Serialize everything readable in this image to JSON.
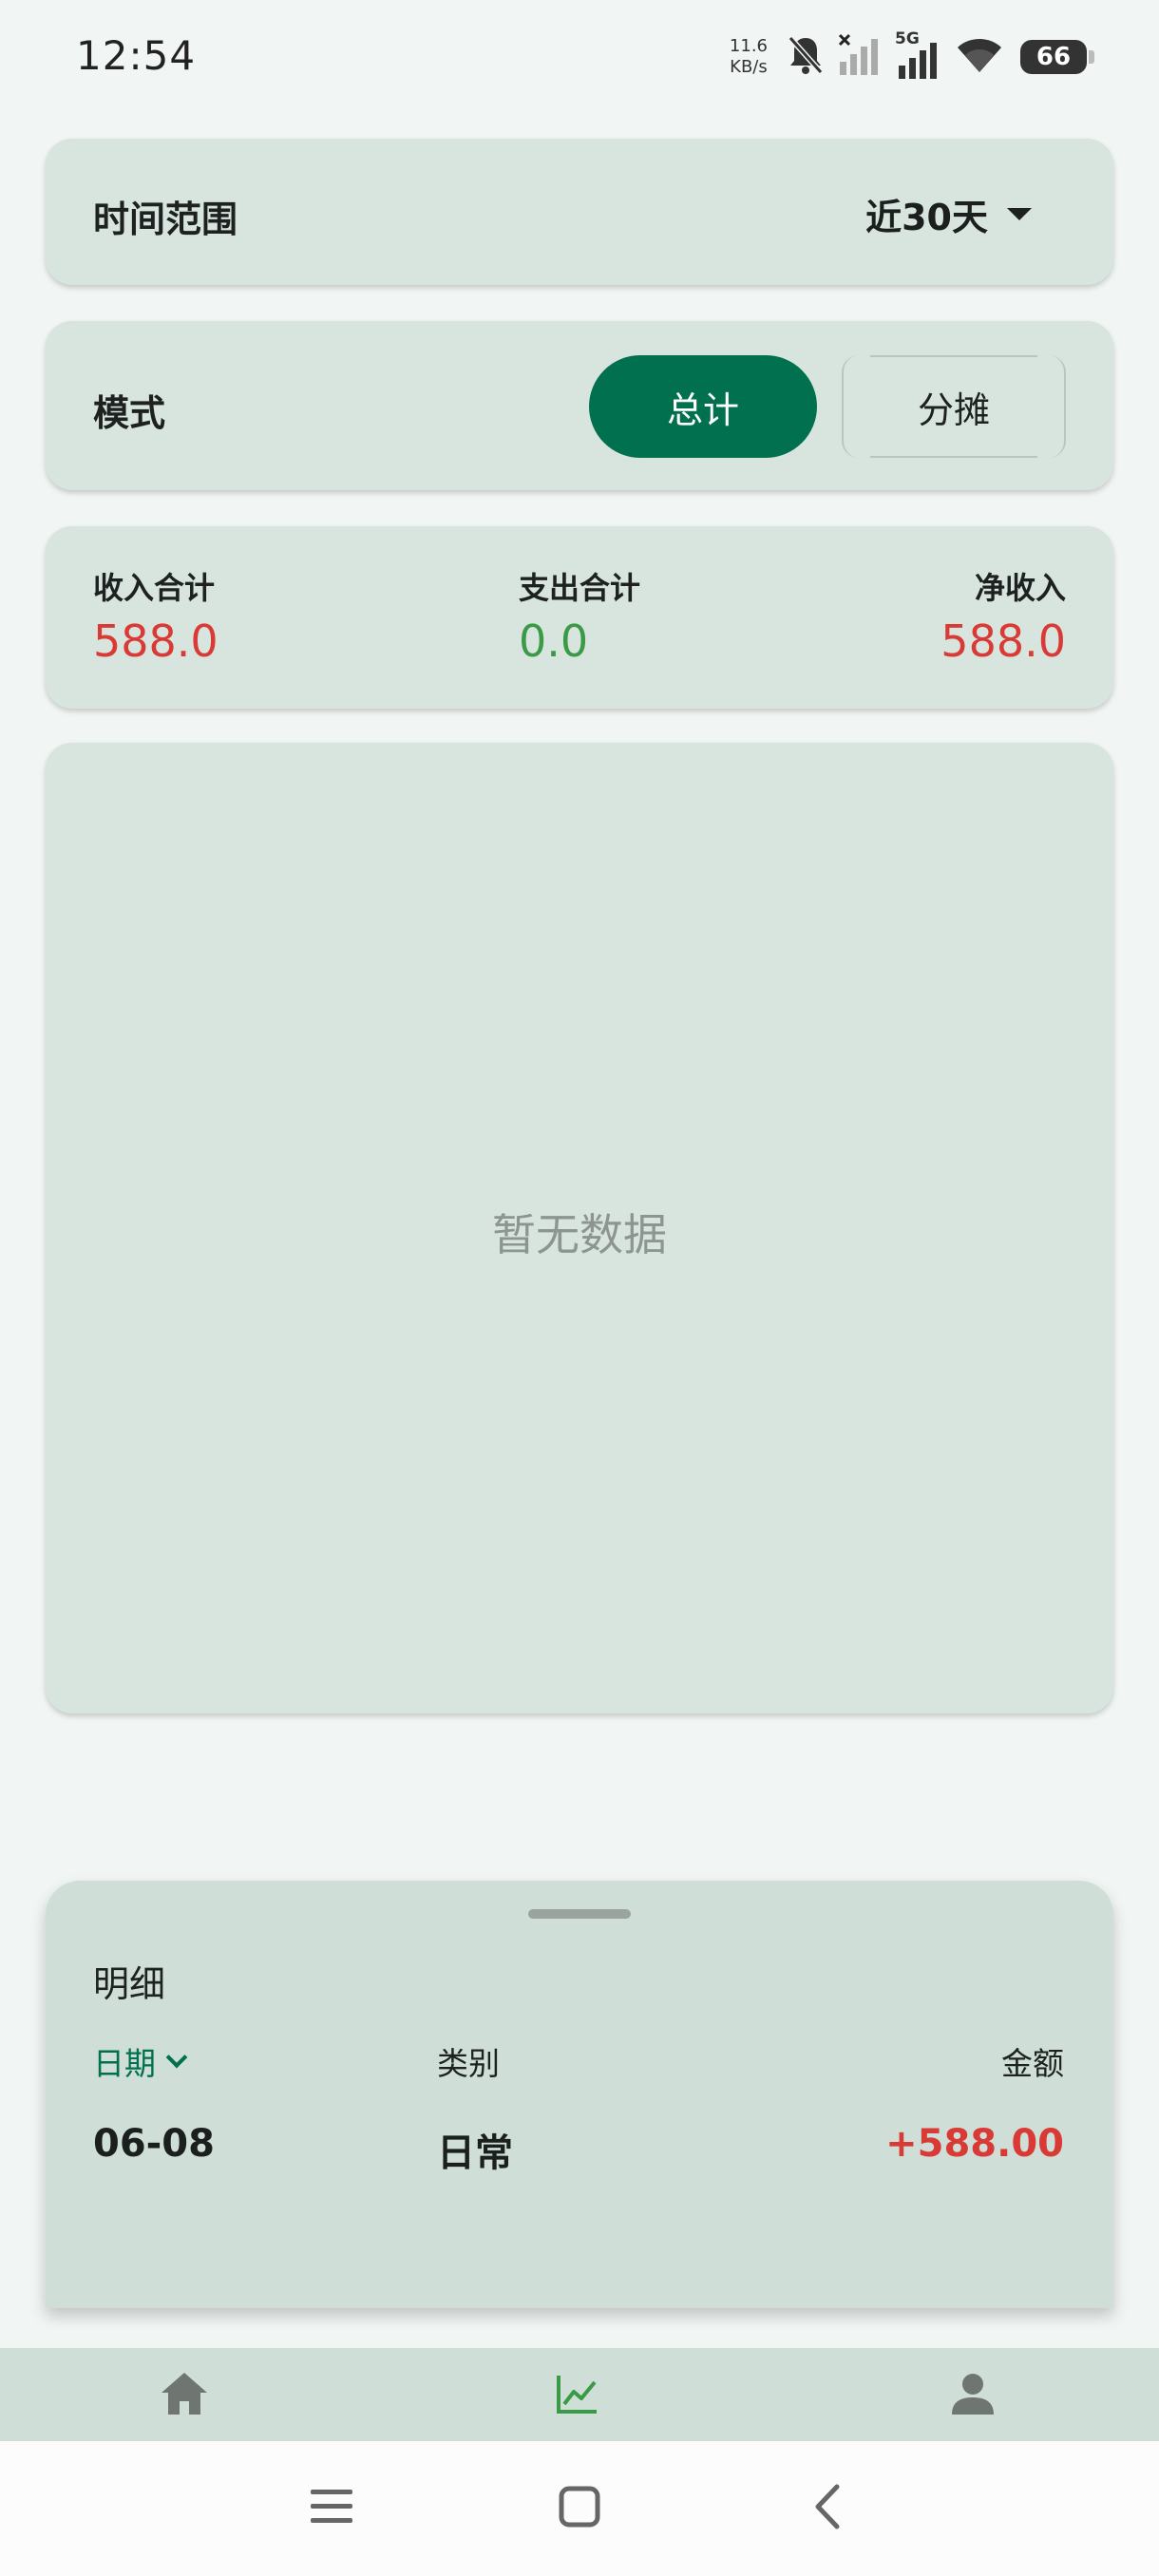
{
  "status_bar": {
    "time": "12:54",
    "net_speed_value": "11.6",
    "net_speed_unit": "KB/s",
    "network_type": "5G",
    "battery_level": "66",
    "icons": [
      "bell-muted-icon",
      "signal-x-icon",
      "signal-5g-icon",
      "wifi-icon",
      "battery-icon"
    ]
  },
  "time_range": {
    "label": "时间范围",
    "value": "近30天"
  },
  "mode": {
    "label": "模式",
    "options": [
      "总计",
      "分摊"
    ],
    "selected": "总计"
  },
  "totals": {
    "income_label": "收入合计",
    "income_value": "588.0",
    "expense_label": "支出合计",
    "expense_value": "0.0",
    "net_label": "净收入",
    "net_value": "588.0"
  },
  "chart": {
    "empty_text": "暂无数据"
  },
  "details": {
    "title": "明细",
    "columns": {
      "date": "日期",
      "category": "类别",
      "amount": "金额"
    },
    "rows": [
      {
        "date": "06-08",
        "category": "日常",
        "amount": "+588.00"
      }
    ]
  },
  "bottom_nav": {
    "items": [
      "home-icon",
      "chart-icon",
      "person-icon"
    ],
    "active": "chart-icon"
  },
  "colors": {
    "primary": "#00704e",
    "income": "#d93a36",
    "expense": "#3a9a45",
    "card": "#d8e4de",
    "background": "#f1f5f3"
  }
}
